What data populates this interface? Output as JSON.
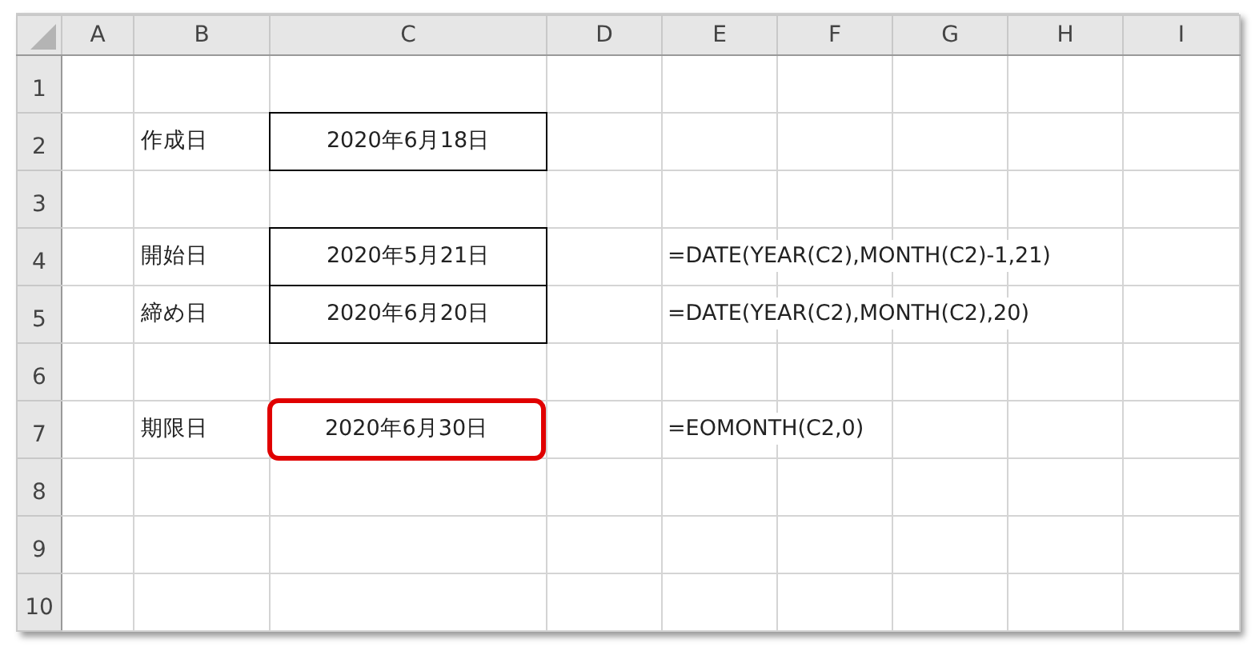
{
  "columns": [
    "A",
    "B",
    "C",
    "D",
    "E",
    "F",
    "G",
    "H",
    "I"
  ],
  "rows": [
    {
      "header": "1"
    },
    {
      "header": "2",
      "column_b": {
        "kind": "label",
        "text": "作成日"
      },
      "column_c": {
        "kind": "boxed",
        "text": "2020年6月18日"
      }
    },
    {
      "header": "3"
    },
    {
      "header": "4",
      "column_b": {
        "kind": "label",
        "text": "開始日"
      },
      "column_c": {
        "kind": "boxed",
        "text": "2020年5月21日"
      },
      "column_e": {
        "kind": "formula",
        "text": "=DATE(YEAR(C2),MONTH(C2)-1,21)"
      }
    },
    {
      "header": "5",
      "column_b": {
        "kind": "label",
        "text": "締め日"
      },
      "column_c": {
        "kind": "boxed",
        "text": "2020年6月20日"
      },
      "column_e": {
        "kind": "formula",
        "text": "=DATE(YEAR(C2),MONTH(C2),20)"
      }
    },
    {
      "header": "6"
    },
    {
      "header": "7",
      "column_b": {
        "kind": "label",
        "text": "期限日"
      },
      "column_c": {
        "kind": "highlighted",
        "text": "2020年6月30日"
      },
      "column_e": {
        "kind": "formula",
        "text": "=EOMONTH(C2,0)"
      }
    },
    {
      "header": "8"
    },
    {
      "header": "9"
    },
    {
      "header": "10"
    }
  ]
}
